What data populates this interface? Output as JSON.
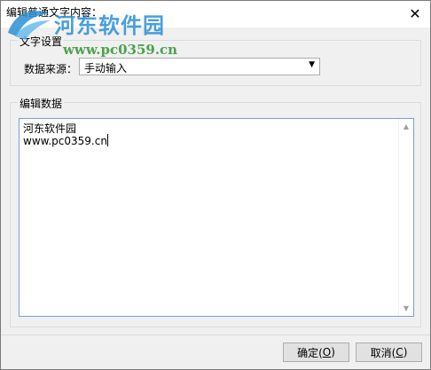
{
  "window": {
    "title": "编辑普通文字内容：",
    "close_glyph": "✕"
  },
  "watermark": {
    "name": "河东软件园",
    "url": "www.pc0359.cn"
  },
  "text_settings": {
    "group_label": "文字设置",
    "source_label": "数据来源：",
    "source_value": "手动输入",
    "dropdown_icon": "▼"
  },
  "edit_data": {
    "group_label": "编辑数据",
    "lines": [
      "河东软件园",
      "www.pc0359.cn"
    ]
  },
  "scrollbar": {
    "up_icon": "▲",
    "down_icon": "▼"
  },
  "buttons": {
    "ok_prefix": "确定(",
    "ok_key": "O",
    "ok_suffix": ")",
    "cancel_prefix": "取消(",
    "cancel_key": "C",
    "cancel_suffix": ")"
  },
  "colors": {
    "watermark_blue": "#2b8fd6",
    "watermark_green": "#3a9a3a",
    "focus_border": "#7a9fd6"
  }
}
